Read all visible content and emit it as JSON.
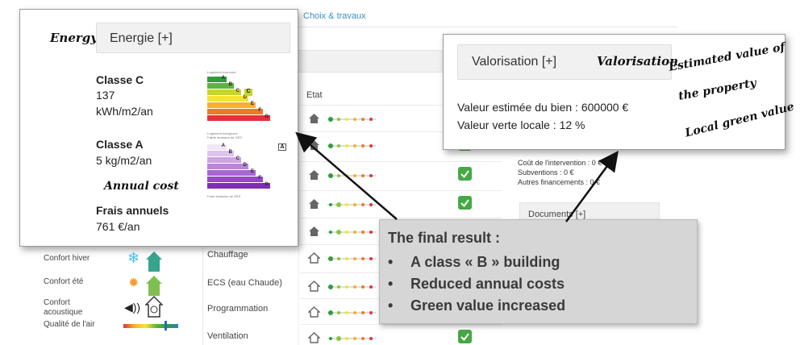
{
  "background": {
    "tab_choix": "Choix & travaux",
    "etat_label": "Etat",
    "labels": {
      "chauffage": "Chauffage",
      "ecs": "ECS (eau Chaude)",
      "programmation": "Programmation",
      "ventilation": "Ventilation"
    },
    "comfort": {
      "hiver": "Confort hiver",
      "ete": "Confort été",
      "acoustique": "Confort acoustique",
      "air": "Qualité de l'air"
    },
    "cost": {
      "intervention": "Coût de l'intervention : 0 €",
      "subventions": "Subventions : 0 €",
      "autres": "Autres financements : 0 €"
    },
    "documents": "Documents [+]"
  },
  "energy": {
    "handwritten": "Energy",
    "header": "Energie [+]",
    "classe_c": "Classe C",
    "value_c": "137",
    "unit_c": "kWh/m2/an",
    "classe_a": "Classe A",
    "value_a": "5 kg/m2/an",
    "annual_cost_note": "Annual cost",
    "frais_label": "Frais annuels",
    "frais_value": "761 €/an",
    "scale_top_caption": "Logement économe",
    "scale_mid_caption": "Logement énergivore",
    "scale_mid_caption2": "Faible émission de GES",
    "scale_bottom_caption": "Forte émission de GES",
    "energy_letters": [
      "A",
      "B",
      "C",
      "D",
      "E",
      "F",
      "G"
    ],
    "energy_colors": [
      "#2f9e3a",
      "#5fb43b",
      "#c6d431",
      "#f4e531",
      "#f3b12f",
      "#ec7a2b",
      "#e2333a"
    ],
    "selected_energy_letter": "C",
    "ges_letters": [
      "A",
      "B",
      "C",
      "D",
      "E",
      "F",
      "G"
    ],
    "ges_colors": [
      "#f1e6f7",
      "#ddc3ee",
      "#cca3e6",
      "#ba85de",
      "#a866d3",
      "#9649c7",
      "#7e2fb5"
    ],
    "selected_ges_letter": "A"
  },
  "valorisation": {
    "header": "Valorisation [+]",
    "handwritten_title": "Valorisation",
    "valeur_estimee": "Valeur estimée du bien : 600000 €",
    "valeur_verte": "Valeur verte locale : 12 %",
    "note_line1": "Estimated value of",
    "note_line2": "the property",
    "note_line3": "Local green value"
  },
  "result": {
    "title": "The final result :",
    "items": [
      "A class « B » building",
      "Reduced annual costs",
      "Green value increased"
    ]
  }
}
